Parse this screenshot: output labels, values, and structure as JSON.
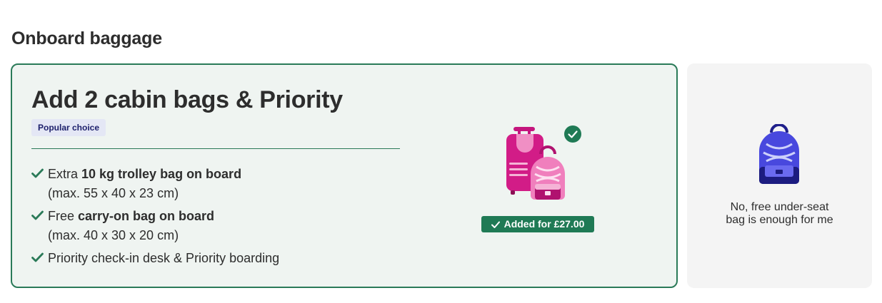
{
  "section": {
    "title": "Onboard baggage"
  },
  "selected_option": {
    "title": "Add 2 cabin bags & Priority",
    "badge": "Popular choice",
    "features": [
      {
        "prefix": "Extra ",
        "bold": "10 kg trolley bag on board",
        "sub": "(max. 55 x 40 x 23 cm)"
      },
      {
        "prefix": "Free ",
        "bold": "carry-on bag on board",
        "sub": "(max. 40 x 30 x 20 cm)"
      },
      {
        "prefix": "Priority check-in desk & Priority boarding",
        "bold": "",
        "sub": ""
      }
    ],
    "added_label": "Added for £27.00",
    "icons": [
      "check-icon",
      "trolley-and-backpack-illustration",
      "check-circle-icon"
    ],
    "colors": {
      "border": "#2a7a58",
      "background": "#eff4f1",
      "badge_bg": "#1f7a55"
    }
  },
  "other_option": {
    "label_line1": "No, free under-seat",
    "label_line2": "bag is enough for me",
    "icon": "backpack-illustration",
    "colors": {
      "background": "#f4f4f4"
    }
  }
}
